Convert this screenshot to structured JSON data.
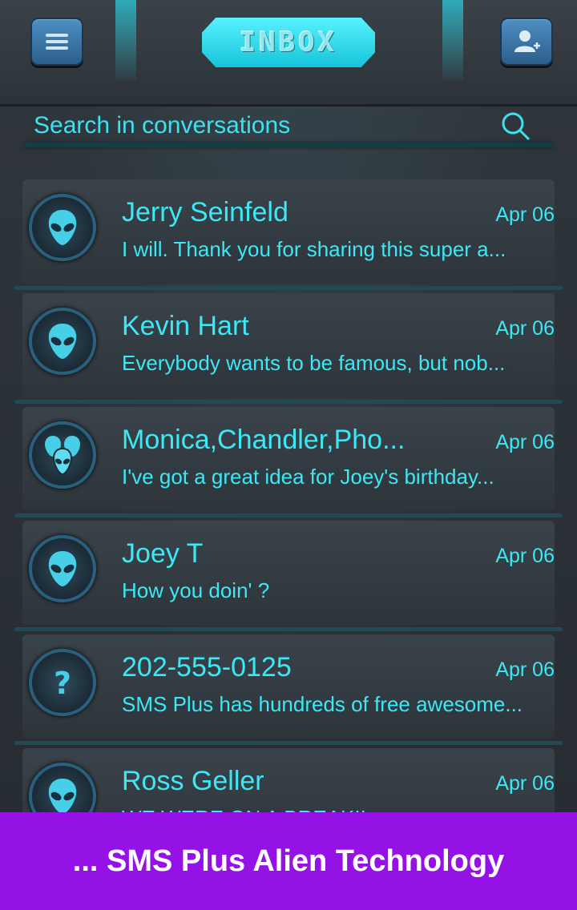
{
  "header": {
    "title": "INBOX",
    "menu_icon": "hamburger-icon",
    "add_icon": "add-contact-icon"
  },
  "search": {
    "placeholder": "Search in conversations"
  },
  "conversations": [
    {
      "name": "Jerry Seinfeld",
      "date": "Apr 06",
      "preview": "I will. Thank you for sharing this super a...",
      "avatar": "alien-icon"
    },
    {
      "name": "Kevin Hart",
      "date": "Apr 06",
      "preview": "Everybody wants to be famous, but nob...",
      "avatar": "alien-icon"
    },
    {
      "name": "Monica,Chandler,Pho...",
      "date": "Apr 06",
      "preview": "I've got a great idea for Joey's birthday...",
      "avatar": "alien-group-icon"
    },
    {
      "name": "Joey T",
      "date": "Apr 06",
      "preview": "How you doin' ?",
      "avatar": "alien-icon"
    },
    {
      "name": "202-555-0125",
      "date": "Apr 06",
      "preview": "SMS Plus has hundreds of free awesome...",
      "avatar": "unknown-contact-icon"
    },
    {
      "name": "Ross Geller",
      "date": "Apr 06",
      "preview": "WE WERE ON A BREAK!!",
      "avatar": "alien-icon"
    }
  ],
  "banner": {
    "text": "... SMS Plus Alien Technology"
  },
  "colors": {
    "accent": "#3ce8f4",
    "banner": "#9512e6",
    "button": "#3a78ad"
  }
}
